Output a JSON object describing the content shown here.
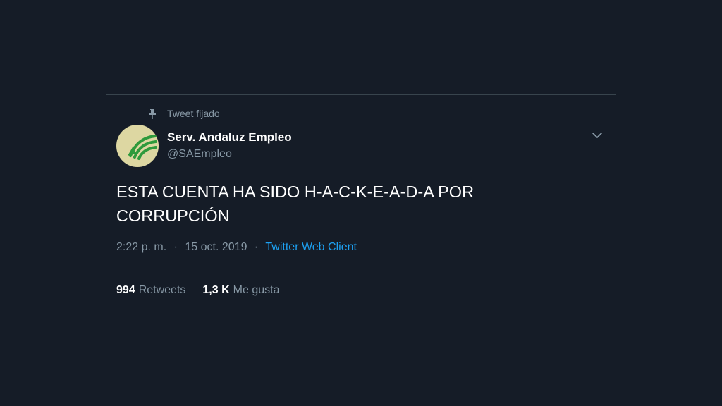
{
  "pinned": {
    "label": "Tweet fijado",
    "icon": "pin-icon"
  },
  "author": {
    "name": "Serv. Andaluz Empleo",
    "handle": "@SAEmpleo_",
    "avatar_icon": "sae-logo-avatar"
  },
  "tweet": {
    "text_line1": "ESTA CUENTA HA SIDO H-A-C-K-E-A-D-A POR",
    "text_line2": "CORRUPCIÓN"
  },
  "meta": {
    "time": "2:22 p. m.",
    "separator": "·",
    "date": "15 oct. 2019",
    "client": "Twitter Web Client"
  },
  "stats": {
    "retweets_count": "994",
    "retweets_label": "Retweets",
    "likes_count": "1,3 K",
    "likes_label": "Me gusta"
  },
  "menu_icon": "chevron-down-icon",
  "colors": {
    "background": "#151c27",
    "secondary_text": "#8899a6",
    "link": "#1da1f2",
    "divider": "#38444d",
    "avatar_bg": "#ddd7a2",
    "avatar_green": "#2e9a3c"
  }
}
